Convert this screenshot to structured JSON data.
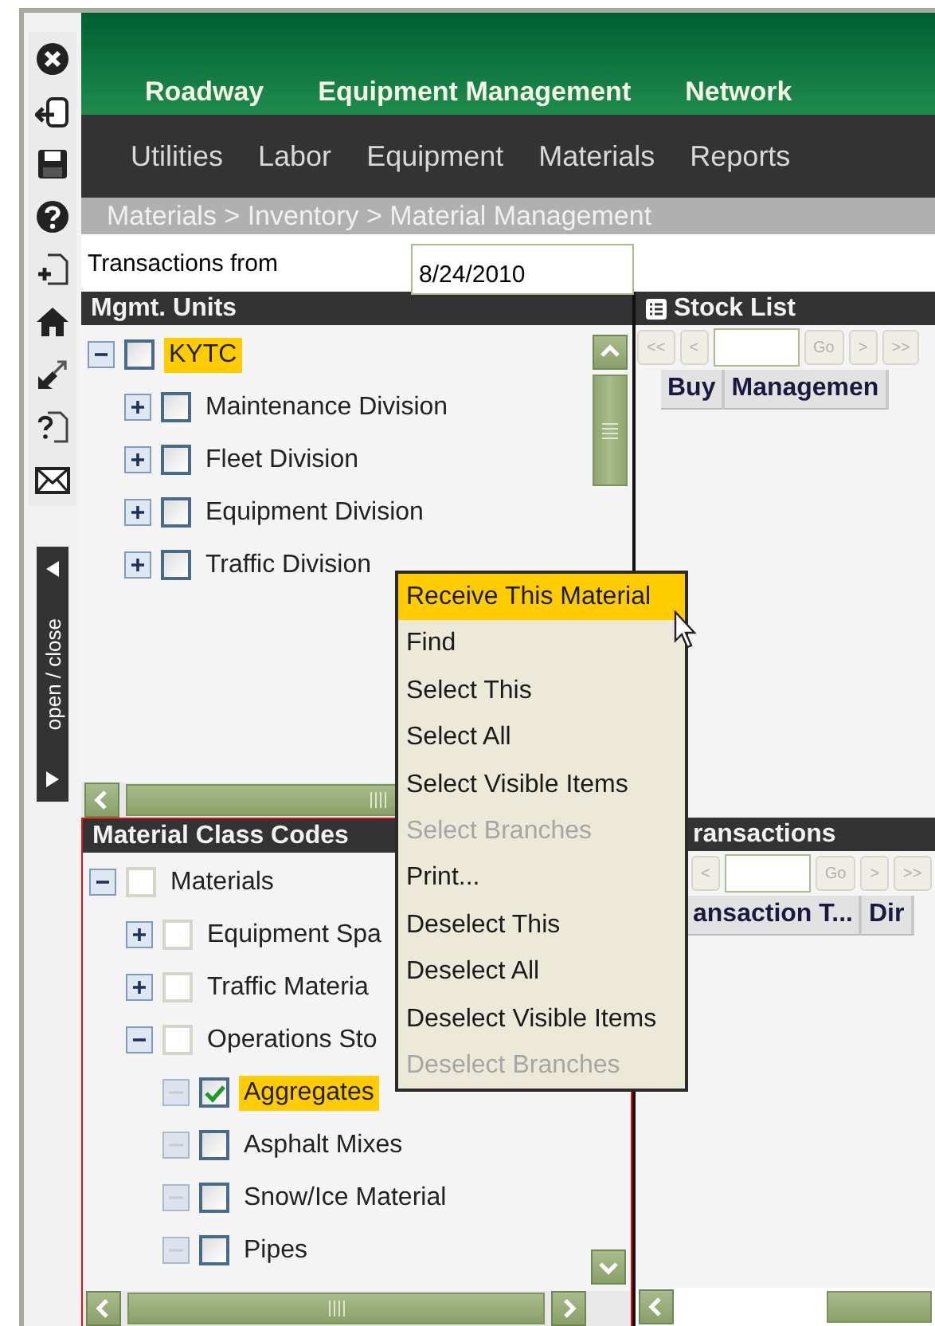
{
  "panel_toggle": {
    "label": "open / close"
  },
  "header_tabs": [
    {
      "label": "Roadway"
    },
    {
      "label": "Equipment Management"
    },
    {
      "label": "Network"
    }
  ],
  "menu_tabs": [
    {
      "label": "Utilities"
    },
    {
      "label": "Labor"
    },
    {
      "label": "Equipment"
    },
    {
      "label": "Materials"
    },
    {
      "label": "Reports"
    }
  ],
  "breadcrumb": "Materials > Inventory > Material Management",
  "date_filter": {
    "label": "Transactions from",
    "value": "8/24/2010"
  },
  "mgmt_units": {
    "title": "Mgmt. Units",
    "tree": [
      {
        "label": "KYTC",
        "expanded": true,
        "checked": false,
        "selected": true,
        "children": [
          {
            "label": "Maintenance Division",
            "expanded": false,
            "checked": false,
            "selected": false
          },
          {
            "label": "Fleet Division",
            "expanded": false,
            "checked": false,
            "selected": false
          },
          {
            "label": "Equipment Division",
            "expanded": false,
            "checked": false,
            "selected": false
          },
          {
            "label": "Traffic Division",
            "expanded": false,
            "checked": false,
            "selected": false
          }
        ]
      }
    ]
  },
  "material_class_codes": {
    "title": "Material Class Codes",
    "tree": [
      {
        "label": "Materials",
        "expanded": true,
        "checked": false,
        "selected": false,
        "children": [
          {
            "label": "Equipment Spa",
            "expanded": false,
            "checked": false,
            "selected": false
          },
          {
            "label": "Traffic Materia",
            "expanded": false,
            "checked": false,
            "selected": false
          },
          {
            "label": "Operations Sto",
            "expanded": true,
            "checked": false,
            "selected": false,
            "children": [
              {
                "label": "Aggregates",
                "checked": true,
                "selected": true
              },
              {
                "label": "Asphalt Mixes",
                "checked": false,
                "selected": false
              },
              {
                "label": "Snow/Ice Material",
                "checked": false,
                "selected": false
              },
              {
                "label": "Pipes",
                "checked": false,
                "selected": false
              }
            ]
          }
        ]
      }
    ]
  },
  "stock_list": {
    "title": "Stock List",
    "pager_before": [
      "<<",
      "<"
    ],
    "pager_after": [
      "Go",
      ">",
      ">>"
    ],
    "columns": [
      "Buy",
      "Managemen"
    ]
  },
  "transactions": {
    "title": "ransactions",
    "pager_before": [
      "<"
    ],
    "pager_after": [
      "Go",
      ">",
      ">>"
    ],
    "columns": [
      "ansaction T...",
      "Dir"
    ]
  },
  "context_menu": [
    {
      "label": "Receive This Material",
      "selected": true,
      "disabled": false
    },
    {
      "label": "Find",
      "selected": false,
      "disabled": false
    },
    {
      "label": "Select This",
      "selected": false,
      "disabled": false
    },
    {
      "label": "Select All",
      "selected": false,
      "disabled": false
    },
    {
      "label": "Select Visible Items",
      "selected": false,
      "disabled": false
    },
    {
      "label": "Select Branches",
      "selected": false,
      "disabled": true
    },
    {
      "label": "Print...",
      "selected": false,
      "disabled": false
    },
    {
      "label": "Deselect This",
      "selected": false,
      "disabled": false
    },
    {
      "label": "Deselect All",
      "selected": false,
      "disabled": false
    },
    {
      "label": "Deselect Visible Items",
      "selected": false,
      "disabled": false
    },
    {
      "label": "Deselect Branches",
      "selected": false,
      "disabled": true
    }
  ]
}
